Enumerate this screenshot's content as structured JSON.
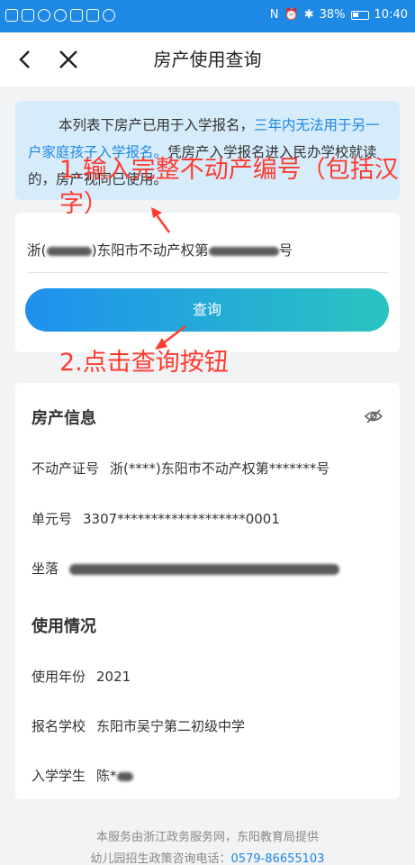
{
  "status_bar": {
    "battery": "38%",
    "time": "10:40"
  },
  "nav": {
    "title": "房产使用查询"
  },
  "notice": {
    "part1": "本列表下房产已用于入学报名，",
    "highlight": "三年内无法用于另一户家庭孩子入学报名。",
    "part2": "凭房产入学报名进入民办学校就读的，房产视同已使用。"
  },
  "search": {
    "prefix": "浙(",
    "middle": ")东阳市不动产权第",
    "suffix": "号",
    "button_label": "查询"
  },
  "annotations": {
    "step1": "1.输入完整不动产编号（包括汉字）",
    "step2": "2.点击查询按钮"
  },
  "property_info": {
    "title": "房产信息",
    "cert_label": "不动产证号",
    "cert_value": "浙(****)东阳市不动产权第*******号",
    "unit_label": "单元号",
    "unit_value": "3307*******************0001",
    "location_label": "坐落"
  },
  "usage_info": {
    "title": "使用情况",
    "year_label": "使用年份",
    "year_value": "2021",
    "school_label": "报名学校",
    "school_value": "东阳市吴宁第二初级中学",
    "student_label": "入学学生",
    "student_value": "陈*"
  },
  "footer": {
    "line1": "本服务由浙江政务服务网，东阳教育局提供",
    "line2_label": "幼儿园招生政策咨询电话：",
    "line2_phone": "0579-86655103"
  }
}
